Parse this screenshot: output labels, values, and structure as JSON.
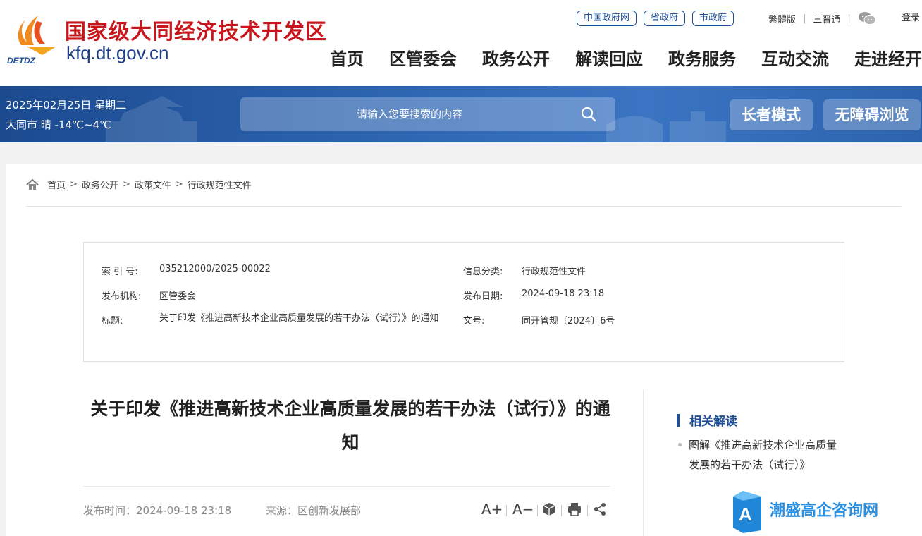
{
  "header": {
    "site_name": "国家级大同经济技术开发区",
    "site_url": "kfq.dt.gov.cn",
    "logo_text": "DETDZ",
    "top_links": [
      "中国政府网",
      "省政府",
      "市政府"
    ],
    "traditional": "繁體版",
    "accessible_site": "三晋通",
    "login": "登录",
    "nav": [
      "首页",
      "区管委会",
      "政务公开",
      "解读回应",
      "政务服务",
      "互动交流",
      "走进经开"
    ]
  },
  "banner": {
    "date": "2025年02月25日 星期二",
    "weather": "大同市 晴 -14℃~4℃",
    "search_placeholder": "请输入您要搜索的内容",
    "elder_mode": "长者模式",
    "barrier_free": "无障碍浏览"
  },
  "breadcrumb": [
    "首页",
    "政务公开",
    "政策文件",
    "行政规范性文件"
  ],
  "info": {
    "index_label": "索 引 号:",
    "index_value": "035212000/2025-00022",
    "category_label": "信息分类:",
    "category_value": "行政规范性文件",
    "org_label": "发布机构:",
    "org_value": "区管委会",
    "date_label": "发布日期:",
    "date_value": "2024-09-18 23:18",
    "title_label": "标题:",
    "title_value": "关于印发《推进高新技术企业高质量发展的若干办法（试行）》的通知",
    "docno_label": "文号:",
    "docno_value": "同开管规〔2024〕6号"
  },
  "article": {
    "title": "关于印发《推进高新技术企业高质量发展的若干办法（试行）》的通知",
    "publish_time": "发布时间：2024-09-18 23:18",
    "source": "来源：区创新发展部",
    "font_larger": "A+",
    "font_smaller": "A−"
  },
  "related": {
    "heading": "相关解读",
    "items": [
      "图解《推进高新技术企业高质量发展的若干办法（试行）》"
    ]
  },
  "watermark": {
    "text": "潮盛高企咨询网",
    "badge": "A"
  },
  "colors": {
    "brand_red": "#c8161d",
    "brand_blue": "#1e4f97",
    "banner_blue": "#2d64b0"
  }
}
